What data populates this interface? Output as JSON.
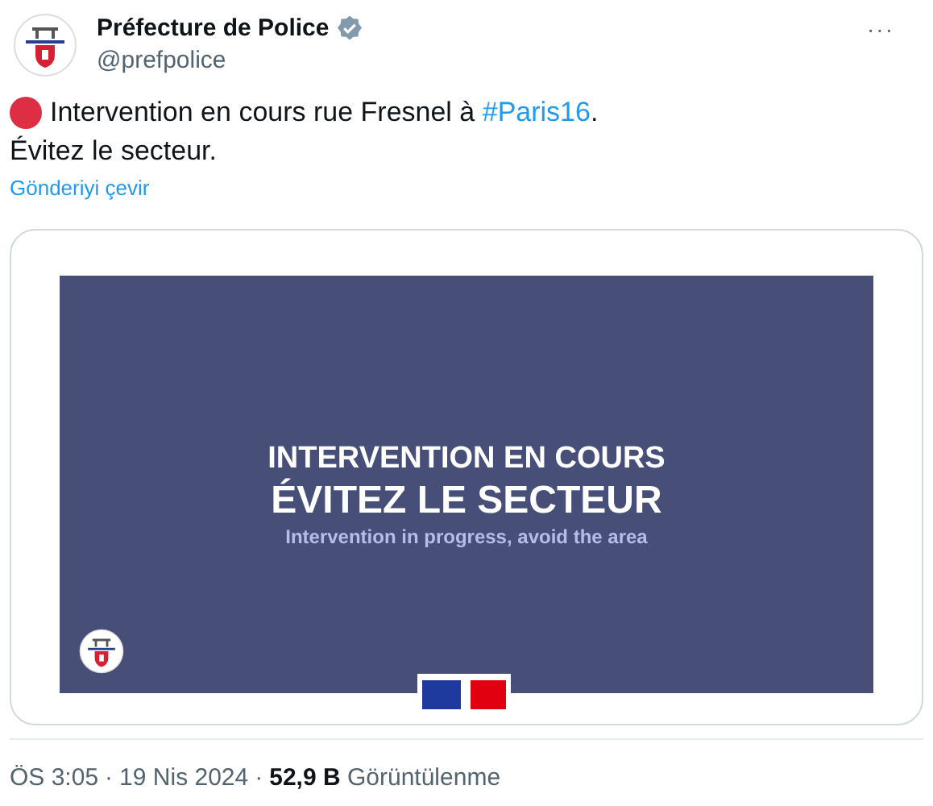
{
  "author": {
    "name": "Préfecture de Police",
    "handle": "@prefpolice",
    "verified": true
  },
  "more_label": "···",
  "post": {
    "line_1_before": "Intervention en cours rue Fresnel à ",
    "hashtag": "#Paris16",
    "line_1_after": ".",
    "line_2": "Évitez le secteur.",
    "translate_link": "Gönderiyi çevir"
  },
  "media": {
    "headline_1": "INTERVENTION EN COURS",
    "headline_2": "ÉVITEZ LE SECTEUR",
    "subtitle": "Intervention in progress, avoid the area"
  },
  "footer": {
    "time": "ÖS 3:05",
    "separator_1": "·",
    "date": "19 Nis 2024",
    "separator_2": "·",
    "views": "**52,9 B** Görüntülenme"
  }
}
